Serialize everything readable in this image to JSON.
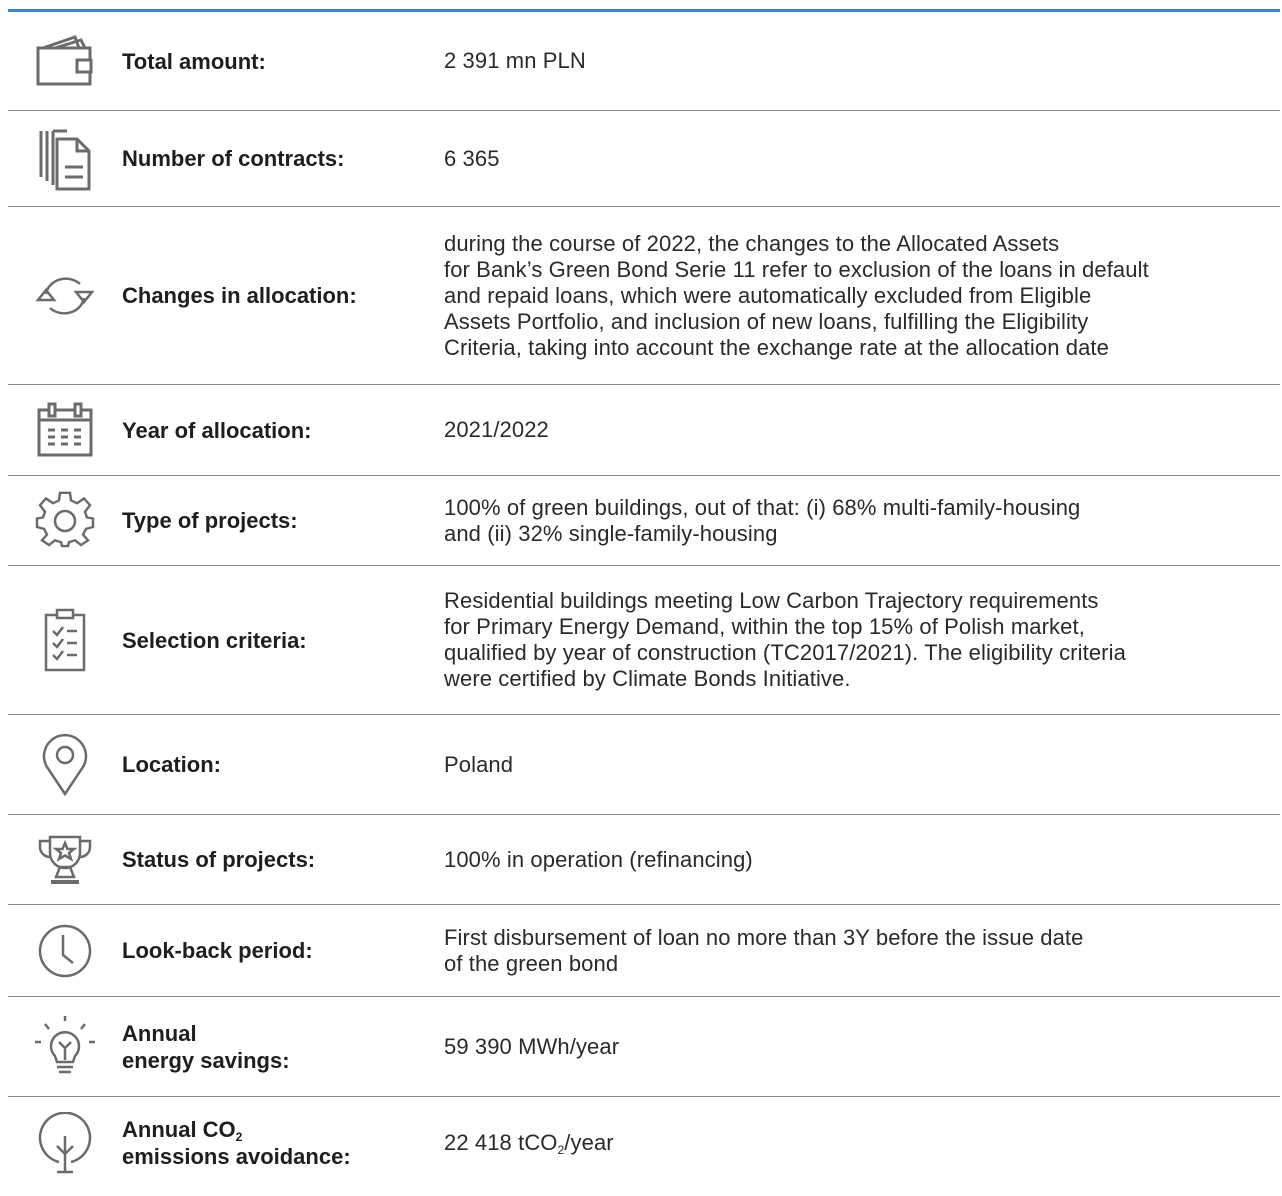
{
  "rows": [
    {
      "label": "Total amount:",
      "value": "2 391 mn PLN",
      "icon": "wallet-icon"
    },
    {
      "label": "Number of contracts:",
      "value": "6 365",
      "icon": "documents-icon"
    },
    {
      "label": "Changes in allocation:",
      "value_lines": [
        "during the course of 2022, the changes to the Allocated Assets",
        "for Bank’s Green Bond Serie 11 refer to exclusion of the loans in default",
        "and repaid loans, which were automatically excluded from Eligible",
        "Assets Portfolio, and inclusion of new loans, fulfilling the Eligibility",
        "Criteria, taking into account the exchange rate at the allocation date"
      ],
      "icon": "refresh-icon"
    },
    {
      "label": "Year of allocation:",
      "value": "2021/2022",
      "icon": "calendar-icon"
    },
    {
      "label": "Type of projects:",
      "value_lines": [
        "100% of green buildings, out of that: (i) 68% multi-family-housing",
        "and (ii) 32% single-family-housing"
      ],
      "icon": "gear-icon"
    },
    {
      "label": "Selection criteria:",
      "value_lines": [
        "Residential buildings meeting Low Carbon Trajectory requirements",
        "for Primary Energy Demand, within the top 15% of Polish market,",
        "qualified by year of construction (TC2017/2021). The eligibility criteria",
        "were certified by Climate Bonds Initiative."
      ],
      "icon": "checklist-icon"
    },
    {
      "label": "Location:",
      "value": "Poland",
      "icon": "location-pin-icon"
    },
    {
      "label": "Status of projects:",
      "value": "100% in operation (refinancing)",
      "icon": "trophy-icon"
    },
    {
      "label": "Look-back period:",
      "value_lines": [
        "First disbursement of loan no more than 3Y before the issue date",
        "of the green bond"
      ],
      "icon": "clock-icon"
    },
    {
      "label_lines": [
        "Annual",
        "energy savings:"
      ],
      "value": "59 390 MWh/year",
      "icon": "lightbulb-icon"
    },
    {
      "label_parts": [
        "Annual CO",
        "2",
        "emissions avoidance:"
      ],
      "value_parts": [
        "22 418 tCO",
        "2",
        "/year"
      ],
      "icon": "tree-icon"
    }
  ]
}
